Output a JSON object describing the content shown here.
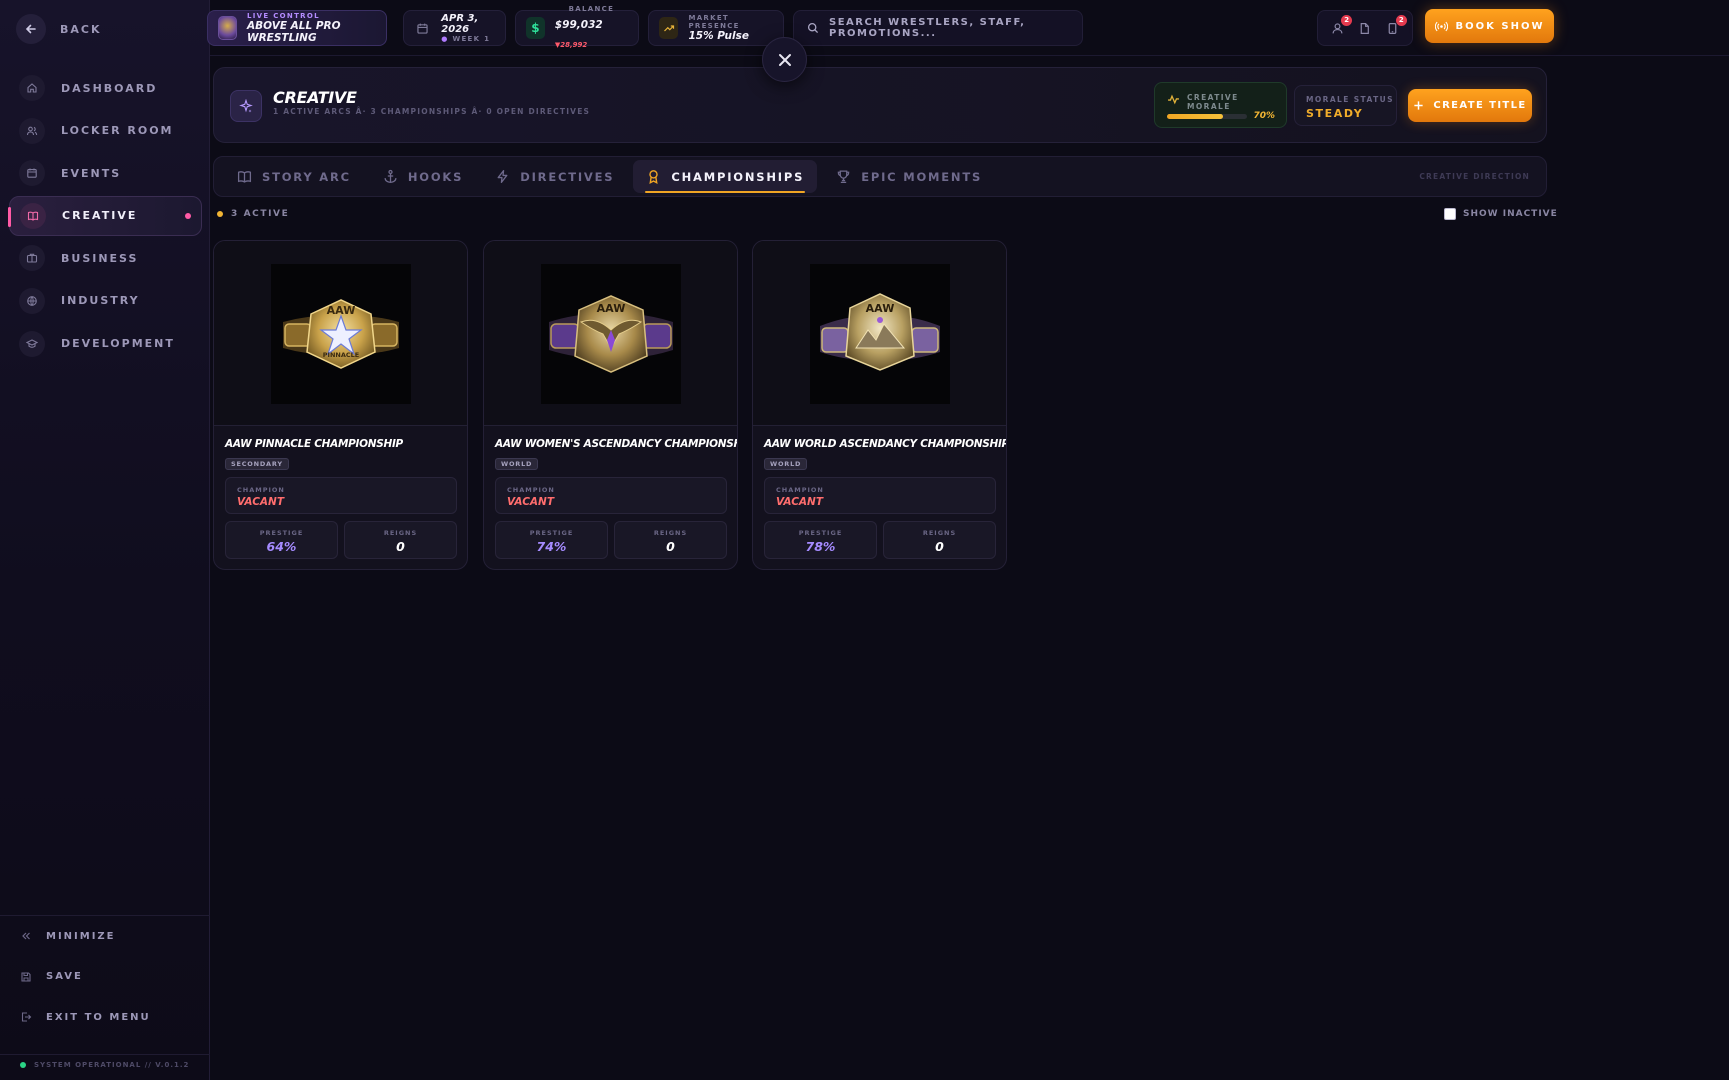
{
  "sidebar": {
    "back_label": "BACK",
    "items": [
      {
        "label": "DASHBOARD",
        "icon": "home-icon"
      },
      {
        "label": "LOCKER ROOM",
        "icon": "users-icon"
      },
      {
        "label": "EVENTS",
        "icon": "calendar-icon"
      },
      {
        "label": "CREATIVE",
        "icon": "book-icon"
      },
      {
        "label": "BUSINESS",
        "icon": "briefcase-icon"
      },
      {
        "label": "INDUSTRY",
        "icon": "globe-icon"
      },
      {
        "label": "DEVELOPMENT",
        "icon": "graduation-cap-icon"
      }
    ],
    "active_item": "CREATIVE",
    "minimize_label": "MINIMIZE",
    "save_label": "SAVE",
    "exit_label": "EXIT TO MENU",
    "status_text": "SYSTEM OPERATIONAL // V.0.1.2"
  },
  "topbar": {
    "live": {
      "small": "LIVE CONTROL",
      "title": "ABOVE ALL PRO WRESTLING"
    },
    "date": {
      "value": "APR 3, 2026",
      "week": "WEEK 1"
    },
    "balance": {
      "small": "BALANCE",
      "value": "$99,032",
      "delta": "▼28,992"
    },
    "market": {
      "small": "MARKET PRESENCE",
      "value": "15% Pulse"
    },
    "search_placeholder": "SEARCH WRESTLERS, STAFF, PROMOTIONS...",
    "badges": {
      "people": "2",
      "tablet": "2"
    },
    "book_label": "BOOK SHOW"
  },
  "header": {
    "title": "CREATIVE",
    "subtitle": "1 ACTIVE ARCS Â· 3 CHAMPIONSHIPS Â· 0 OPEN DIRECTIVES",
    "morale_label": "CREATIVE MORALE",
    "morale_value": 70,
    "morale_text": "70%",
    "status_label": "MORALE STATUS",
    "status_value": "STEADY",
    "create_label": "CREATE TITLE"
  },
  "tabs": [
    {
      "label": "STORY ARC",
      "icon": "book-open-icon"
    },
    {
      "label": "HOOKS",
      "icon": "anchor-icon"
    },
    {
      "label": "DIRECTIVES",
      "icon": "lightning-icon"
    },
    {
      "label": "CHAMPIONSHIPS",
      "icon": "award-icon"
    },
    {
      "label": "EPIC MOMENTS",
      "icon": "trophy-icon"
    }
  ],
  "active_tab": "CHAMPIONSHIPS",
  "tabs_right_label": "CREATIVE DIRECTION",
  "filter": {
    "count_label": "3 ACTIVE",
    "show_inactive_label": "SHOW INACTIVE",
    "show_inactive_checked": false
  },
  "championships": [
    {
      "name": "AAW PINNACLE CHAMPIONSHIP",
      "tier": "SECONDARY",
      "champion_label": "CHAMPION",
      "champion": "VACANT",
      "prestige_label": "PRESTIGE",
      "prestige": "64%",
      "reigns_label": "REIGNS",
      "reigns": "0",
      "plate_text": "AAW",
      "plate_sub": "PINNACLE"
    },
    {
      "name": "AAW WOMEN'S ASCENDANCY CHAMPIONSHIP",
      "tier": "WORLD",
      "champion_label": "CHAMPION",
      "champion": "VACANT",
      "prestige_label": "PRESTIGE",
      "prestige": "74%",
      "reigns_label": "REIGNS",
      "reigns": "0",
      "plate_text": "AAW",
      "plate_sub": ""
    },
    {
      "name": "AAW WORLD ASCENDANCY CHAMPIONSHIP",
      "tier": "WORLD",
      "champion_label": "CHAMPION",
      "champion": "VACANT",
      "prestige_label": "PRESTIGE",
      "prestige": "78%",
      "reigns_label": "REIGNS",
      "reigns": "0",
      "plate_text": "AAW",
      "plate_sub": ""
    }
  ],
  "colors": {
    "accent": "#f0a524",
    "creative_pink": "#ff5aa6",
    "vacant": "#ff6d6d",
    "prestige": "#a58bff",
    "belt_gold": "#c9a24a",
    "belt_purple": "#5b3a8c"
  }
}
